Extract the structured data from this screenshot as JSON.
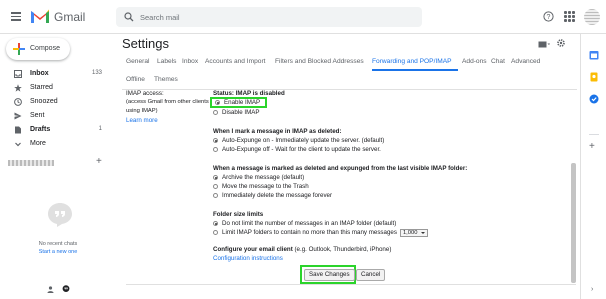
{
  "app": {
    "brand": "Gmail"
  },
  "search": {
    "placeholder": "Search mail"
  },
  "compose": {
    "label": "Compose"
  },
  "nav": [
    {
      "label": "Inbox",
      "count": "133",
      "icon": "inbox-icon",
      "bold": true
    },
    {
      "label": "Starred",
      "count": "",
      "icon": "star-icon",
      "bold": false
    },
    {
      "label": "Snoozed",
      "count": "",
      "icon": "clock-icon",
      "bold": false
    },
    {
      "label": "Sent",
      "count": "",
      "icon": "send-icon",
      "bold": false
    },
    {
      "label": "Drafts",
      "count": "1",
      "icon": "draft-icon",
      "bold": true
    },
    {
      "label": "More",
      "count": "",
      "icon": "chevron-down-icon",
      "bold": false
    }
  ],
  "hangouts": {
    "no_chats": "No recent chats",
    "start_new": "Start a new one"
  },
  "settings": {
    "title": "Settings",
    "tabs": [
      "General",
      "Labels",
      "Inbox",
      "Accounts and Import",
      "Filters and Blocked Addresses",
      "Forwarding and POP/IMAP",
      "Add-ons",
      "Chat",
      "Advanced",
      "Offline",
      "Themes"
    ],
    "active_tab": "Forwarding and POP/IMAP",
    "imap_access": {
      "label": "IMAP access:",
      "hint1": "(access Gmail from other clients",
      "hint2": "using IMAP)",
      "learn_more": "Learn more",
      "status": "Status: IMAP is disabled",
      "enable": "Enable IMAP",
      "disable": "Disable IMAP",
      "selected": "enable"
    },
    "deleted": {
      "heading": "When I mark a message in IMAP as deleted:",
      "options": [
        {
          "label": "Auto-Expunge on - Immediately update the server. (default)",
          "selected": true
        },
        {
          "label": "Auto-Expunge off - Wait for the client to update the server.",
          "selected": false
        }
      ]
    },
    "expunged": {
      "heading": "When a message is marked as deleted and expunged from the last visible IMAP folder:",
      "options": [
        {
          "label": "Archive the message (default)",
          "selected": true
        },
        {
          "label": "Move the message to the Trash",
          "selected": false
        },
        {
          "label": "Immediately delete the message forever",
          "selected": false
        }
      ]
    },
    "folder_limits": {
      "heading": "Folder size limits",
      "options": [
        {
          "label": "Do not limit the number of messages in an IMAP folder (default)",
          "selected": true
        },
        {
          "label": "Limit IMAP folders to contain no more than this many messages",
          "selected": false
        }
      ],
      "limit_value": "1,000"
    },
    "configure": {
      "heading": "Configure your email client",
      "hint": "(e.g. Outlook, Thunderbird, iPhone)",
      "link": "Configuration instructions"
    },
    "save_label": "Save Changes",
    "cancel_label": "Cancel"
  },
  "colors": {
    "accent": "#1a73e8",
    "highlight": "#2bd42b",
    "brand_red": "#ea4335"
  }
}
